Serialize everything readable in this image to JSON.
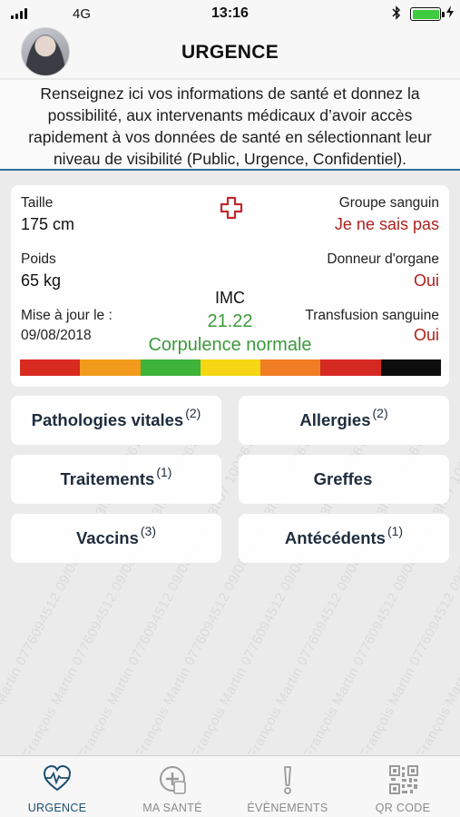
{
  "status_bar": {
    "carrier": "4G",
    "time": "13:16"
  },
  "header": {
    "title": "URGENCE"
  },
  "intro": {
    "text": "Renseignez ici vos informations de santé et donnez la possibilité, aux intervenants médicaux d’avoir accès rapidement à vos données de santé en sélectionnant leur niveau de visibilité (Public, Urgence, Confidentiel)."
  },
  "summary": {
    "height_label": "Taille",
    "height_value": "175 cm",
    "weight_label": "Poids",
    "weight_value": "65 kg",
    "updated_label": "Mise à jour le :",
    "updated_value": "09/08/2018",
    "blood_group_label": "Groupe sanguin",
    "blood_group_value": "Je ne sais pas",
    "organ_donor_label": "Donneur d'organe",
    "organ_donor_value": "Oui",
    "transfusion_label": "Transfusion sanguine",
    "transfusion_value": "Oui",
    "imc_label": "IMC",
    "imc_value": "21.22",
    "imc_status": "Corpulence normale",
    "scale_colors": [
      "#d62b1e",
      "#f19a1b",
      "#3db33a",
      "#f4d612",
      "#f07c24",
      "#d42a22",
      "#0d0d0d"
    ]
  },
  "categories": [
    {
      "label": "Pathologies vitales",
      "count": "(2)"
    },
    {
      "label": "Allergies",
      "count": "(2)"
    },
    {
      "label": "Traitements",
      "count": "(1)"
    },
    {
      "label": "Greffes",
      "count": ""
    },
    {
      "label": "Vaccins",
      "count": "(3)"
    },
    {
      "label": "Antécédents",
      "count": "(1)"
    }
  ],
  "watermark": {
    "text": "François Martin 0776094512 09/08/2018 23h07 100067"
  },
  "tabs": [
    {
      "label": "URGENCE",
      "icon": "heart-pulse-icon",
      "active": true
    },
    {
      "label": "MA SANTÉ",
      "icon": "medical-folder-icon",
      "active": false
    },
    {
      "label": "ÉVÈNEMENTS",
      "icon": "exclamation-icon",
      "active": false
    },
    {
      "label": "QR CODE",
      "icon": "qr-code-icon",
      "active": false
    }
  ],
  "colors": {
    "accent": "#1c4f73",
    "alert_red": "#b0211d",
    "bmi_green": "#3c9a3c"
  }
}
